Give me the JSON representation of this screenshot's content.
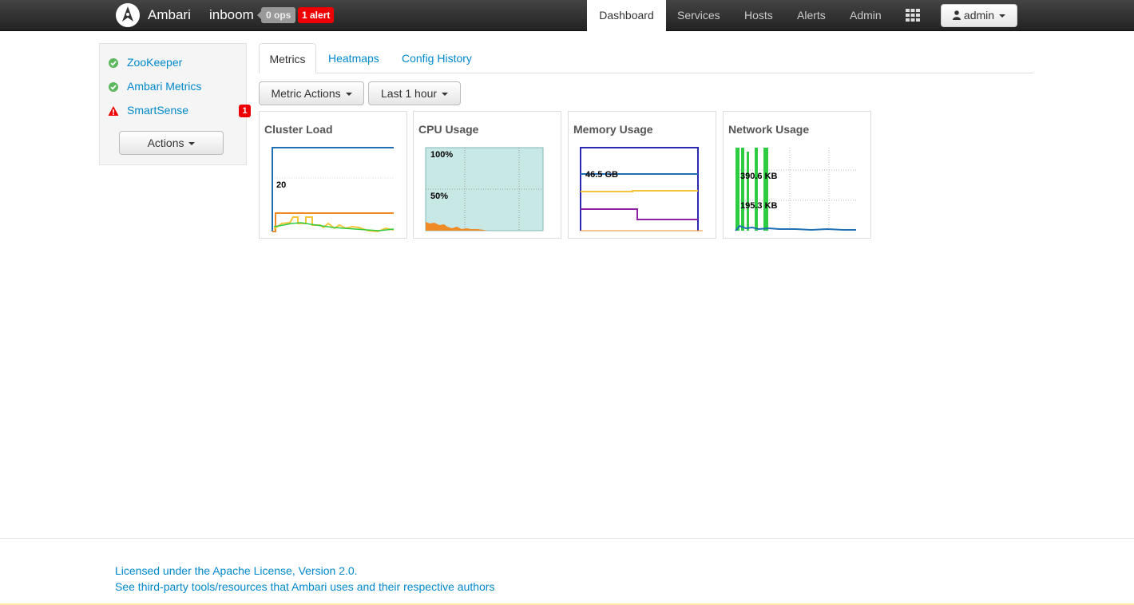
{
  "header": {
    "brand": "Ambari",
    "cluster_name": "inboom",
    "ops_badge": "0 ops",
    "alerts_badge": "1 alert",
    "nav": [
      "Dashboard",
      "Services",
      "Hosts",
      "Alerts",
      "Admin"
    ],
    "active_nav": "Dashboard",
    "user_label": "admin"
  },
  "sidebar": {
    "services": [
      {
        "label": "ZooKeeper",
        "status": "ok",
        "status_icon": "check-circle-icon"
      },
      {
        "label": "Ambari Metrics",
        "status": "ok",
        "status_icon": "check-circle-icon"
      },
      {
        "label": "SmartSense",
        "status": "alert",
        "status_icon": "warning-triangle-icon",
        "alert_count": "1"
      }
    ],
    "actions_label": "Actions"
  },
  "tabs": [
    "Metrics",
    "Heatmaps",
    "Config History"
  ],
  "active_tab": "Metrics",
  "toolbar": {
    "metric_actions": "Metric Actions",
    "time_range": "Last 1 hour"
  },
  "widgets": [
    {
      "title": "Cluster Load",
      "label": "20"
    },
    {
      "title": "CPU Usage",
      "label_top": "100%",
      "label_mid": "50%"
    },
    {
      "title": "Memory Usage",
      "label": "46.5 GB"
    },
    {
      "title": "Network Usage",
      "label_top": "390.6 KB",
      "label_mid": "195.3 KB"
    }
  ],
  "colors": {
    "link": "#0088cc",
    "ok": "#5cb85c",
    "alert": "#ee0000",
    "cpu_fill": "#c8e8e6",
    "series_blue": "#1f6fb5",
    "series_orange": "#f08a24",
    "series_yellow": "#f5c53a",
    "series_purple": "#8e1fa7",
    "series_green": "#2ecc40"
  },
  "footer": {
    "license": "Licensed under the Apache License, Version 2.0.",
    "third_party": "See third-party tools/resources that Ambari uses and their respective authors"
  }
}
